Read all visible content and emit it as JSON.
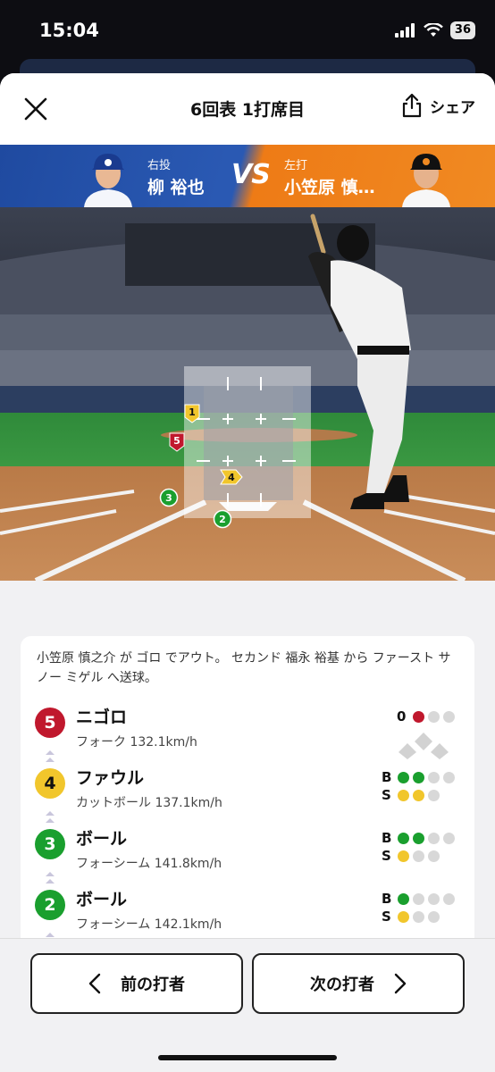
{
  "status": {
    "time": "15:04",
    "battery": "36"
  },
  "header": {
    "title": "6回表 1打席目",
    "share_label": "シェア"
  },
  "matchup": {
    "pitcher_hand": "右投",
    "pitcher_name": "柳 裕也",
    "vs": "VS",
    "batter_hand": "左打",
    "batter_name": "小笠原 慎…"
  },
  "field": {
    "markers": [
      {
        "num": "1",
        "color": "#f1c62c",
        "shape": "flag"
      },
      {
        "num": "2",
        "color": "#1a9f2e",
        "shape": "circle"
      },
      {
        "num": "3",
        "color": "#1a9f2e",
        "shape": "circle"
      },
      {
        "num": "4",
        "color": "#f1c62c",
        "shape": "flag"
      },
      {
        "num": "5",
        "color": "#c0182d",
        "shape": "flag"
      }
    ]
  },
  "log": {
    "summary": "小笠原 慎之介 が ゴロ でアウト。 セカンド 福永 裕基 から ファースト サノー ミゲル へ送球。",
    "pitches": [
      {
        "num": "5",
        "color": "#c0182d",
        "result": "ニゴロ",
        "type": "フォーク 132.1km/h",
        "outs_label": "0",
        "outs": 0
      },
      {
        "num": "4",
        "color": "#f1c62c",
        "result": "ファウル",
        "type": "カットボール 137.1km/h",
        "balls": 2,
        "strikes": 2
      },
      {
        "num": "3",
        "color": "#1a9f2e",
        "result": "ボール",
        "type": "フォーシーム 141.8km/h",
        "balls": 2,
        "strikes": 1
      },
      {
        "num": "2",
        "color": "#1a9f2e",
        "result": "ボール",
        "type": "フォーシーム 142.1km/h",
        "balls": 1,
        "strikes": 1
      }
    ],
    "ball_letter": "B",
    "strike_letter": "S"
  },
  "nav": {
    "prev_label": "前の打者",
    "next_label": "次の打者"
  }
}
